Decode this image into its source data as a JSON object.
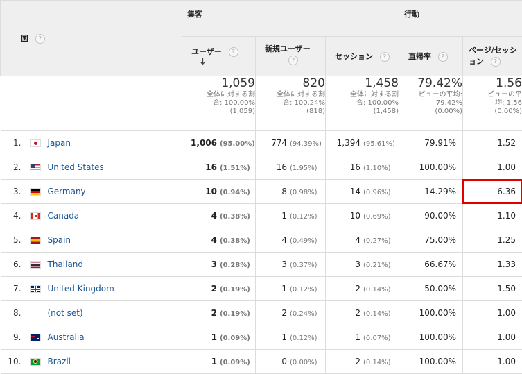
{
  "header": {
    "country_label": "国",
    "group_acquisition": "集客",
    "group_behavior": "行動",
    "help_glyph": "?",
    "sort_glyph": "↓",
    "columns": {
      "users": "ユーザー",
      "new_users": "新規ユーザー",
      "sessions": "セッション",
      "bounce_rate": "直帰率",
      "pages_per_session": "ページ/セッション"
    }
  },
  "summary": {
    "users": {
      "value": "1,059",
      "sub1": "全体に対する割",
      "sub2": "合: 100.00%",
      "sub3": "(1,059)"
    },
    "new_users": {
      "value": "820",
      "sub1": "全体に対する割",
      "sub2": "合: 100.24%",
      "sub3": "(818)"
    },
    "sessions": {
      "value": "1,458",
      "sub1": "全体に対する割",
      "sub2": "合: 100.00%",
      "sub3": "(1,458)"
    },
    "bounce_rate": {
      "value": "79.42%",
      "sub1": "ビューの平均:",
      "sub2": "79.42%",
      "sub3": "(0.00%)"
    },
    "pages_per_session": {
      "value": "1.56",
      "sub1": "ビューの平",
      "sub2": "均: 1.56",
      "sub3": "(0.00%)"
    }
  },
  "rows": [
    {
      "idx": "1.",
      "flag": "jp",
      "country": "Japan",
      "users": "1,006",
      "users_pct": "(95.00%)",
      "new_users": "774",
      "new_users_pct": "(94.39%)",
      "sessions": "1,394",
      "sessions_pct": "(95.61%)",
      "bounce": "79.91%",
      "pages": "1.52"
    },
    {
      "idx": "2.",
      "flag": "us",
      "country": "United States",
      "users": "16",
      "users_pct": "(1.51%)",
      "new_users": "16",
      "new_users_pct": "(1.95%)",
      "sessions": "16",
      "sessions_pct": "(1.10%)",
      "bounce": "100.00%",
      "pages": "1.00"
    },
    {
      "idx": "3.",
      "flag": "de",
      "country": "Germany",
      "users": "10",
      "users_pct": "(0.94%)",
      "new_users": "8",
      "new_users_pct": "(0.98%)",
      "sessions": "14",
      "sessions_pct": "(0.96%)",
      "bounce": "14.29%",
      "pages": "6.36"
    },
    {
      "idx": "4.",
      "flag": "ca",
      "country": "Canada",
      "users": "4",
      "users_pct": "(0.38%)",
      "new_users": "1",
      "new_users_pct": "(0.12%)",
      "sessions": "10",
      "sessions_pct": "(0.69%)",
      "bounce": "90.00%",
      "pages": "1.10"
    },
    {
      "idx": "5.",
      "flag": "es",
      "country": "Spain",
      "users": "4",
      "users_pct": "(0.38%)",
      "new_users": "4",
      "new_users_pct": "(0.49%)",
      "sessions": "4",
      "sessions_pct": "(0.27%)",
      "bounce": "75.00%",
      "pages": "1.25"
    },
    {
      "idx": "6.",
      "flag": "th",
      "country": "Thailand",
      "users": "3",
      "users_pct": "(0.28%)",
      "new_users": "3",
      "new_users_pct": "(0.37%)",
      "sessions": "3",
      "sessions_pct": "(0.21%)",
      "bounce": "66.67%",
      "pages": "1.33"
    },
    {
      "idx": "7.",
      "flag": "gb",
      "country": "United Kingdom",
      "users": "2",
      "users_pct": "(0.19%)",
      "new_users": "1",
      "new_users_pct": "(0.12%)",
      "sessions": "2",
      "sessions_pct": "(0.14%)",
      "bounce": "50.00%",
      "pages": "1.50"
    },
    {
      "idx": "8.",
      "flag": "none",
      "country": "(not set)",
      "users": "2",
      "users_pct": "(0.19%)",
      "new_users": "2",
      "new_users_pct": "(0.24%)",
      "sessions": "2",
      "sessions_pct": "(0.14%)",
      "bounce": "100.00%",
      "pages": "1.00"
    },
    {
      "idx": "9.",
      "flag": "au",
      "country": "Australia",
      "users": "1",
      "users_pct": "(0.09%)",
      "new_users": "1",
      "new_users_pct": "(0.12%)",
      "sessions": "1",
      "sessions_pct": "(0.07%)",
      "bounce": "100.00%",
      "pages": "1.00"
    },
    {
      "idx": "10.",
      "flag": "br",
      "country": "Brazil",
      "users": "1",
      "users_pct": "(0.09%)",
      "new_users": "0",
      "new_users_pct": "(0.00%)",
      "sessions": "2",
      "sessions_pct": "(0.14%)",
      "bounce": "100.00%",
      "pages": "1.00"
    }
  ],
  "highlight": {
    "row": 2,
    "column": "pages",
    "color": "#e00000"
  },
  "colors": {
    "link": "#1a5694",
    "header_bg": "#efefef",
    "border": "#dcdcdc"
  }
}
